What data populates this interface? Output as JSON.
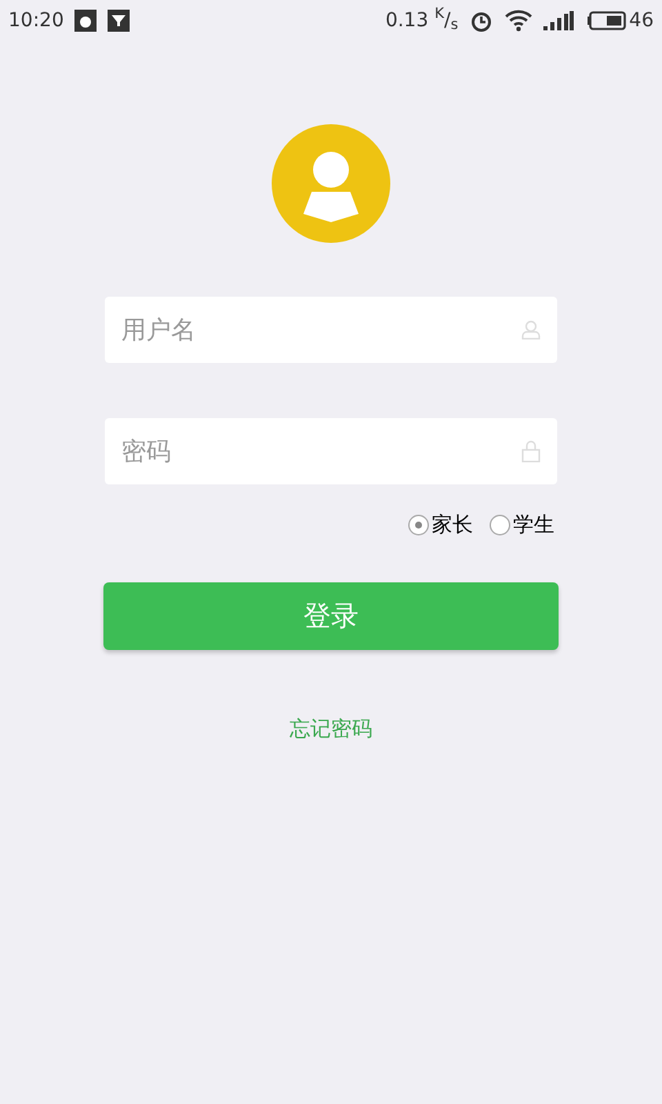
{
  "status_bar": {
    "time": "10:20",
    "speed": "0.13 $^{K}$/$_{s}$",
    "battery": "46"
  },
  "username": {
    "placeholder": "用户名"
  },
  "password": {
    "placeholder": "密码"
  },
  "roles": [
    {
      "label": "家长",
      "selected": true
    },
    {
      "label": "学生",
      "selected": false
    }
  ],
  "login_button": "登录",
  "forgot_link": "忘记密码"
}
